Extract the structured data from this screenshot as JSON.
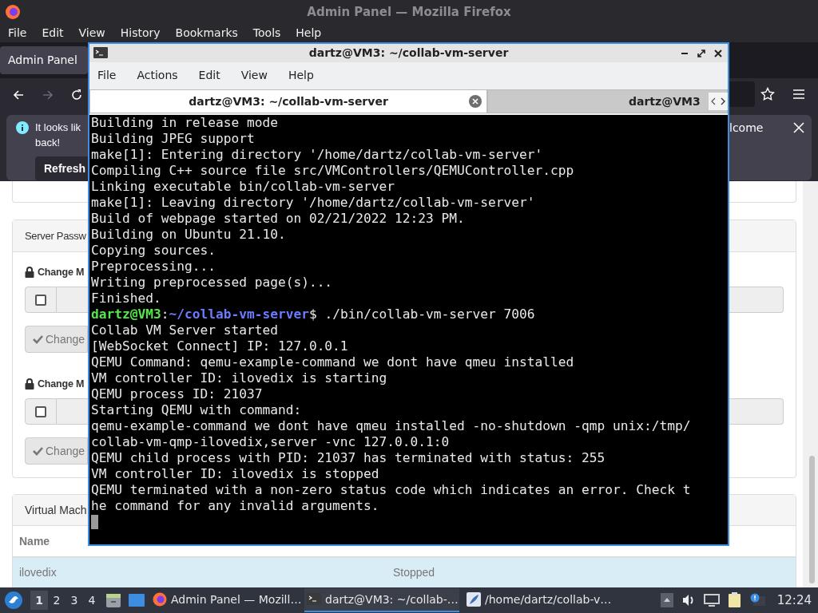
{
  "firefox": {
    "title": "Admin Panel — Mozilla Firefox",
    "menu": [
      "File",
      "Edit",
      "View",
      "History",
      "Bookmarks",
      "Tools",
      "Help"
    ],
    "tabs": [
      {
        "label": "Admin Panel",
        "selected": true
      }
    ],
    "nav_buttons": [
      {
        "kind": "back",
        "disabled": false
      },
      {
        "kind": "forward",
        "disabled": true
      },
      {
        "kind": "reload",
        "disabled": false
      }
    ],
    "notification": {
      "message_lines": [
        "It looks lik",
        "back!"
      ],
      "message_right": "lcome",
      "button": "Refresh"
    },
    "page": {
      "server_password": {
        "header": "Server Passw",
        "fields": [
          {
            "label": "Change M",
            "checked": false,
            "button": "Change"
          },
          {
            "label": "Change M",
            "checked": false,
            "button": "Change"
          }
        ]
      },
      "virtual_machines": {
        "header": "Virtual Mach",
        "columns": [
          "Name"
        ],
        "rows": [
          {
            "name": "ilovedix",
            "status": "Stopped",
            "selected": true
          }
        ]
      }
    }
  },
  "terminal": {
    "title": "dartz@VM3: ~/collab-vm-server",
    "menu": [
      "File",
      "Actions",
      "Edit",
      "View",
      "Help"
    ],
    "tabs": [
      {
        "label": "dartz@VM3: ~/collab-vm-server",
        "selected": true
      },
      {
        "label": "dartz@VM3",
        "selected": false
      }
    ],
    "lines": [
      {
        "kind": "output",
        "text": "Building in release mode"
      },
      {
        "kind": "output",
        "text": "Building JPEG support"
      },
      {
        "kind": "output",
        "text": "make[1]: Entering directory '/home/dartz/collab-vm-server'"
      },
      {
        "kind": "output",
        "text": "Compiling C++ source file src/VMControllers/QEMUController.cpp"
      },
      {
        "kind": "output",
        "text": "Linking executable bin/collab-vm-server"
      },
      {
        "kind": "output",
        "text": "make[1]: Leaving directory '/home/dartz/collab-vm-server'"
      },
      {
        "kind": "output",
        "text": "Build of webpage started on 02/21/2022 12:23 PM."
      },
      {
        "kind": "output",
        "text": "Building on Ubuntu 21.10."
      },
      {
        "kind": "output",
        "text": "Copying sources."
      },
      {
        "kind": "output",
        "text": "Preprocessing..."
      },
      {
        "kind": "output",
        "text": "Writing preprocessed page(s)..."
      },
      {
        "kind": "output",
        "text": "Finished."
      },
      {
        "kind": "prompt",
        "user_host": "dartz@VM3",
        "separator": ":",
        "path": "~/collab-vm-server",
        "command": "$ ./bin/collab-vm-server 7006"
      },
      {
        "kind": "output",
        "text": "Collab VM Server started"
      },
      {
        "kind": "output",
        "text": "[WebSocket Connect] IP: 127.0.0.1"
      },
      {
        "kind": "output",
        "text": "QEMU Command: qemu-example-command we dont have qmeu installed"
      },
      {
        "kind": "output",
        "text": "VM controller ID: ilovedix is starting"
      },
      {
        "kind": "output",
        "text": "QEMU process ID: 21037"
      },
      {
        "kind": "output",
        "text": "Starting QEMU with command:"
      },
      {
        "kind": "output",
        "text": "qemu-example-command we dont have qmeu installed -no-shutdown -qmp unix:/tmp/"
      },
      {
        "kind": "output",
        "text": "collab-vm-qmp-ilovedix,server -vnc 127.0.0.1:0"
      },
      {
        "kind": "output",
        "text": "QEMU child process with PID: 21037 has terminated with status: 255"
      },
      {
        "kind": "output",
        "text": "VM controller ID: ilovedix is stopped"
      },
      {
        "kind": "output",
        "text": "QEMU terminated with a non-zero status code which indicates an error. Check t"
      },
      {
        "kind": "output",
        "text": "he command for any invalid arguments."
      },
      {
        "kind": "cursor"
      }
    ]
  },
  "taskbar": {
    "workspaces": [
      {
        "label": "1",
        "selected": true
      },
      {
        "label": "2",
        "selected": false
      },
      {
        "label": "3",
        "selected": false
      },
      {
        "label": "4",
        "selected": false
      }
    ],
    "tasks": [
      {
        "kind": "browser",
        "label": "Admin Panel — Mozill…",
        "selected": false
      },
      {
        "kind": "terminal",
        "label": "dartz@VM3: ~/collab-…",
        "selected": true
      },
      {
        "kind": "editor",
        "label": "/home/dartz/collab-v…",
        "selected": false
      }
    ],
    "clock": "12:24"
  }
}
